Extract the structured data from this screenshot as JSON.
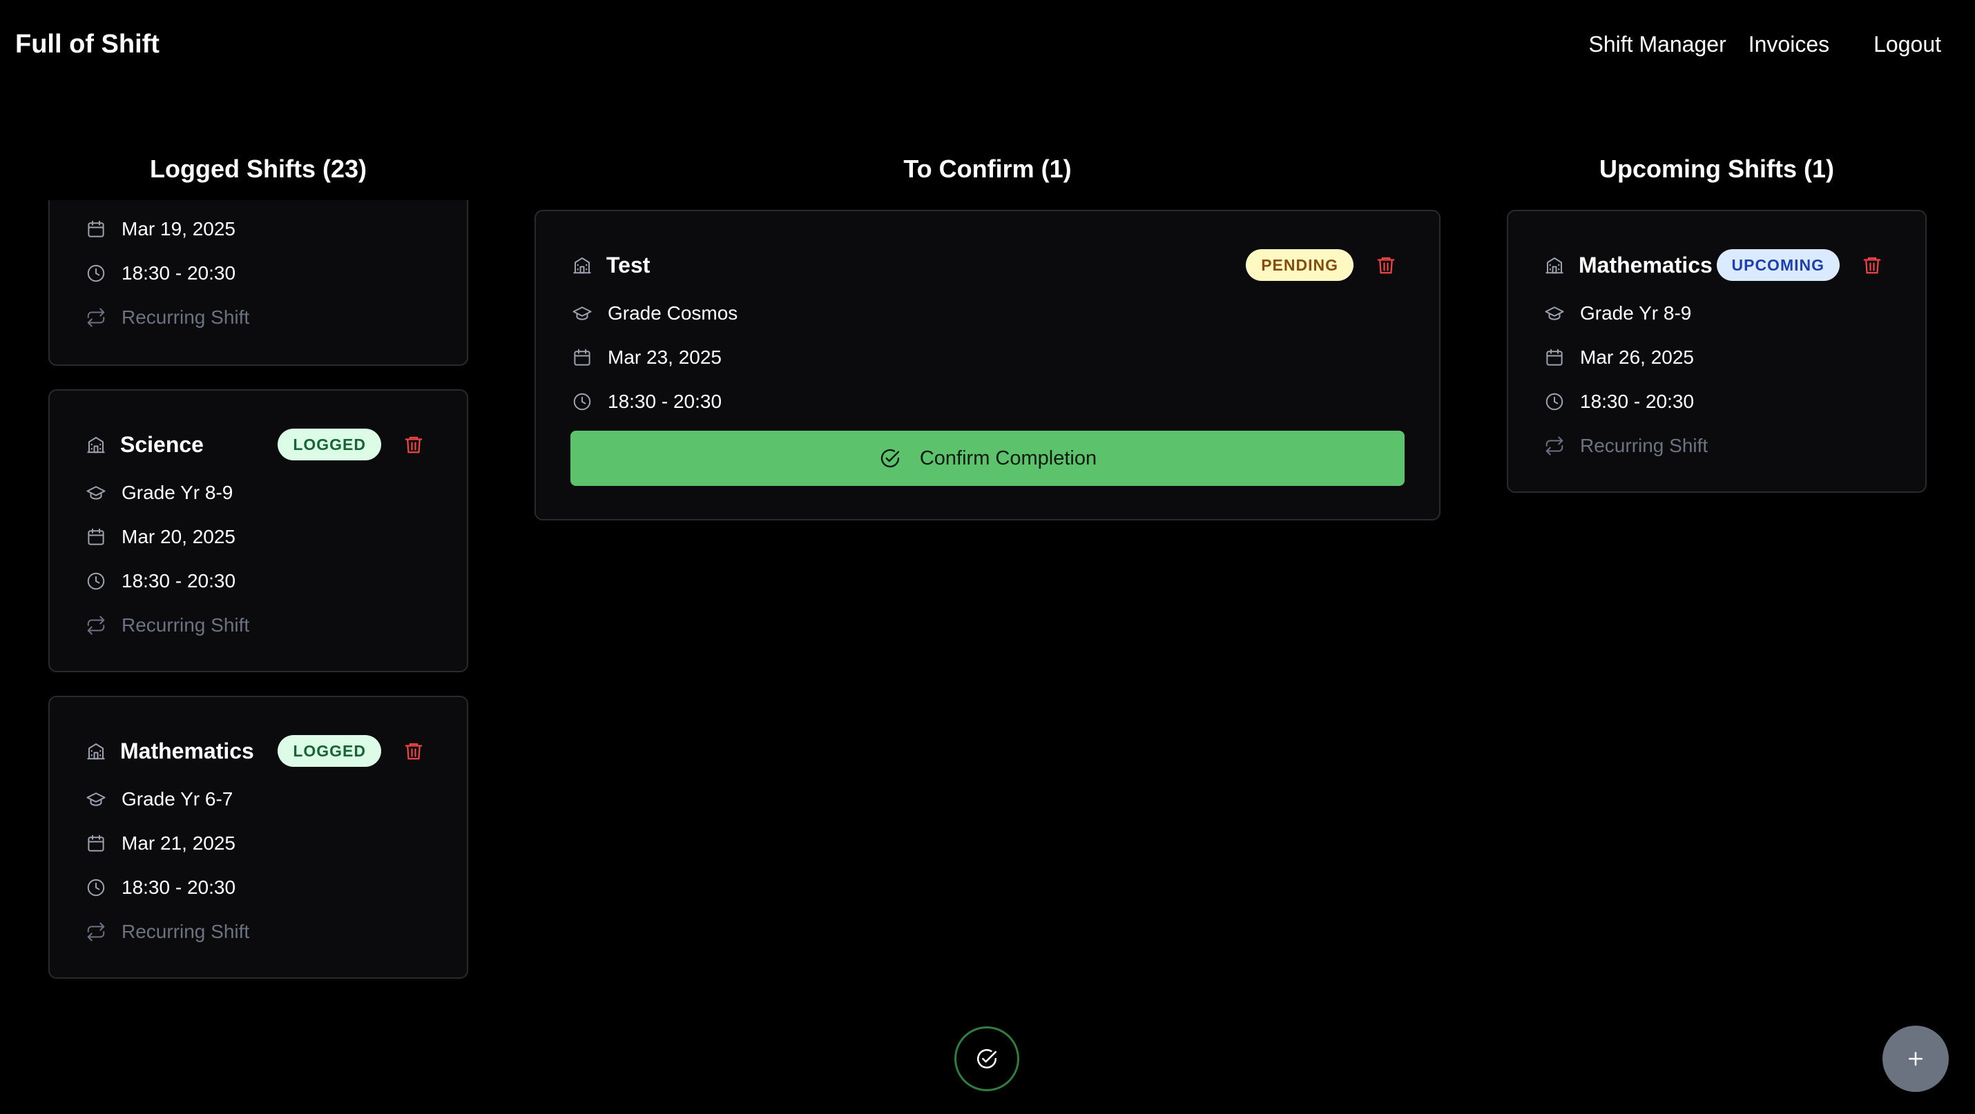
{
  "navbar": {
    "brand": "Full of Shift",
    "links": [
      "Shift Manager",
      "Invoices"
    ],
    "logout": "Logout"
  },
  "columns": {
    "logged": {
      "title": "Logged Shifts (23)",
      "cards": [
        {
          "date": "Mar 19, 2025",
          "time": "18:30 - 20:30",
          "recurring": "Recurring Shift"
        },
        {
          "subject": "Science",
          "badge": "LOGGED",
          "grade": "Grade Yr 8-9",
          "date": "Mar 20, 2025",
          "time": "18:30 - 20:30",
          "recurring": "Recurring Shift"
        },
        {
          "subject": "Mathematics",
          "badge": "LOGGED",
          "grade": "Grade Yr 6-7",
          "date": "Mar 21, 2025",
          "time": "18:30 - 20:30",
          "recurring": "Recurring Shift"
        }
      ]
    },
    "confirm": {
      "title": "To Confirm (1)",
      "cards": [
        {
          "subject": "Test",
          "badge": "PENDING",
          "grade": "Grade Cosmos",
          "date": "Mar 23, 2025",
          "time": "18:30 - 20:30",
          "button": "Confirm Completion"
        }
      ]
    },
    "upcoming": {
      "title": "Upcoming Shifts (1)",
      "cards": [
        {
          "subject": "Mathematics",
          "badge": "UPCOMING",
          "grade": "Grade Yr 8-9",
          "date": "Mar 26, 2025",
          "time": "18:30 - 20:30",
          "recurring": "Recurring Shift"
        }
      ]
    }
  },
  "icons": {
    "building": "building-icon",
    "grade": "graduation-cap-icon",
    "date": "calendar-icon",
    "time": "clock-icon",
    "recurring": "repeat-icon",
    "delete": "trash-icon",
    "confirm": "check-circle-icon",
    "add": "plus-icon"
  },
  "colors": {
    "background": "#000000",
    "card": "#0b0b0d",
    "confirm_button": "#5cc26b",
    "trash": "#ef4444",
    "muted": "#6b7280",
    "fab": "#6b7280"
  }
}
